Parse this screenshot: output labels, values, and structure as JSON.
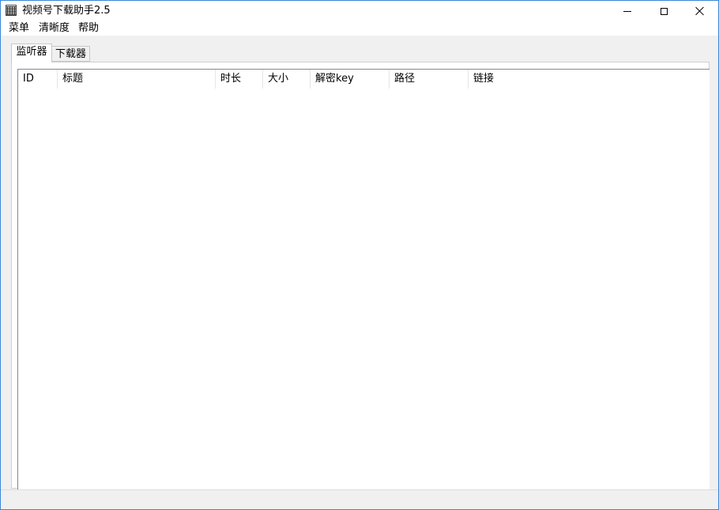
{
  "window": {
    "title": "视频号下载助手2.5",
    "icon": "app-icon",
    "caption_buttons": [
      "minimize-icon",
      "maximize-icon",
      "close-icon"
    ]
  },
  "menubar": {
    "items": [
      {
        "label": "菜单"
      },
      {
        "label": "清晰度"
      },
      {
        "label": "帮助"
      }
    ]
  },
  "tabs": [
    {
      "label": "监听器",
      "selected": true
    },
    {
      "label": "下载器",
      "selected": false
    }
  ],
  "table": {
    "columns": [
      {
        "label": "ID"
      },
      {
        "label": "标题"
      },
      {
        "label": "时长"
      },
      {
        "label": "大小"
      },
      {
        "label": "解密key"
      },
      {
        "label": "路径"
      },
      {
        "label": "链接"
      }
    ],
    "rows": []
  },
  "colors": {
    "window_border": "#3a87d6",
    "background": "#f0f0f0",
    "panel": "#ffffff"
  }
}
